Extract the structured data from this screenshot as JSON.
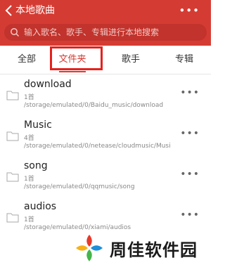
{
  "header": {
    "title": "本地歌曲",
    "more": "•••",
    "background": "#d43c33"
  },
  "search": {
    "placeholder": "输入歌名、歌手、专辑进行本地搜索",
    "icon": "search-icon"
  },
  "tabs": [
    {
      "label": "全部"
    },
    {
      "label": "文件夹",
      "active": true
    },
    {
      "label": "歌手"
    },
    {
      "label": "专辑"
    }
  ],
  "folders": [
    {
      "name": "download",
      "count": "1首",
      "path": "/storage/emulated/0/Baidu_music/download",
      "more": "•••"
    },
    {
      "name": "Music",
      "count": "4首",
      "path": "/storage/emulated/0/netease/cloudmusic/Musi",
      "more": "•••"
    },
    {
      "name": "song",
      "count": "1首",
      "path": "/storage/emulated/0/qqmusic/song",
      "more": "•••"
    },
    {
      "name": "audios",
      "count": "1首",
      "path": "/storage/emulated/0/xiami/audios",
      "more": "•••"
    }
  ],
  "watermark": {
    "text": "周佳软件园"
  },
  "colors": {
    "accent": "#d43c33",
    "highlight": "#e5211c"
  }
}
